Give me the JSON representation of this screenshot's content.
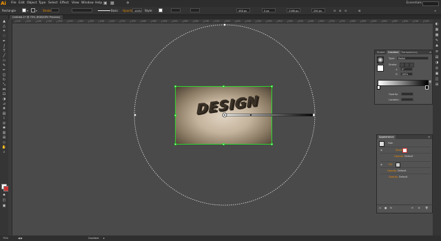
{
  "app": {
    "logo": "Ai"
  },
  "menu": {
    "items": [
      "File",
      "Edit",
      "Object",
      "Type",
      "Select",
      "Effect",
      "View",
      "Window",
      "Help"
    ],
    "workspace": "Essentials"
  },
  "control_bar": {
    "selection_label": "Rectangle",
    "stroke_label": "Stroke:",
    "brush_label": "Basic",
    "opacity_label": "Opacity:",
    "opacity_value": "100%",
    "style_label": "Style:",
    "w_value": "458 px",
    "h_value": "0 px",
    "x_value": "2166 px",
    "y_value": "290 px",
    "fill_color": "#ffffff",
    "stroke_color": "#2a2a2a"
  },
  "document_tab": {
    "title": "Untitled-1* @ 75% (RGB/GPU Preview)"
  },
  "ruler": {
    "ticks": [
      "1200",
      "1250",
      "1300",
      "1350",
      "1400",
      "1450",
      "1500",
      "1550",
      "1600",
      "1650",
      "1700",
      "1750",
      "1800",
      "1850",
      "1900",
      "1950",
      "2000",
      "2050",
      "2100",
      "2150",
      "2200",
      "2250",
      "2300",
      "2350",
      "2400",
      "2450",
      "2500",
      "2550",
      "2600",
      "2650",
      "2700",
      "2750",
      "2800",
      "2850",
      "2900",
      "2950",
      "3000",
      "3050",
      "3100",
      "3150"
    ]
  },
  "canvas": {
    "artboard_text": "DESIGN",
    "selection_color": "#2ed52e"
  },
  "gradient_panel": {
    "tabs": [
      "Stroke",
      "Gradient",
      "Transparency"
    ],
    "type_label": "Type:",
    "type_value": "Radial",
    "stroke_label": "Stroke:",
    "angle_value": "0°",
    "aspect_value": "100%",
    "opacity_label": "Opacity:",
    "location_label": "Location:"
  },
  "appearance_panel": {
    "title": "Appearance",
    "path_label": "Path",
    "stroke_label": "Stroke:",
    "fill_label": "Fill:",
    "rows": [
      {
        "label": "Opacity:",
        "value": "Default"
      },
      {
        "label": "Opacity:",
        "value": "Default"
      },
      {
        "label": "Opacity:",
        "value": "Default"
      }
    ]
  },
  "status_bar": {
    "zoom": "75%",
    "tool": "Gradient"
  }
}
